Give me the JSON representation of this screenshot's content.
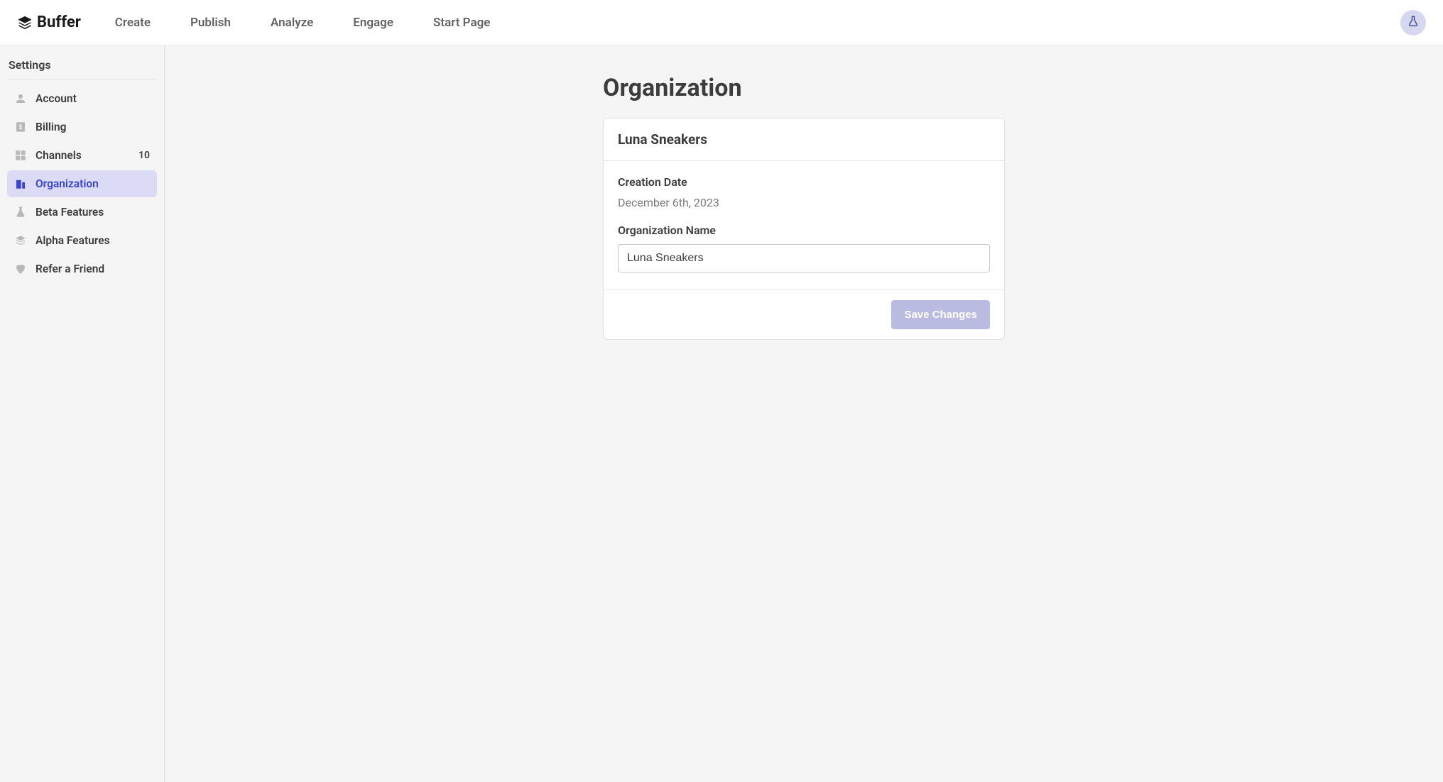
{
  "topbar": {
    "brand": "Buffer",
    "nav": [
      "Create",
      "Publish",
      "Analyze",
      "Engage",
      "Start Page"
    ]
  },
  "sidebar": {
    "title": "Settings",
    "items": [
      {
        "icon": "person",
        "label": "Account"
      },
      {
        "icon": "dollar",
        "label": "Billing"
      },
      {
        "icon": "grid",
        "label": "Channels",
        "count": "10"
      },
      {
        "icon": "building",
        "label": "Organization",
        "active": true
      },
      {
        "icon": "flask",
        "label": "Beta Features"
      },
      {
        "icon": "layers",
        "label": "Alpha Features"
      },
      {
        "icon": "heart",
        "label": "Refer a Friend"
      }
    ]
  },
  "main": {
    "title": "Organization",
    "card": {
      "header": "Luna Sneakers",
      "creation_date_label": "Creation Date",
      "creation_date_value": "December 6th, 2023",
      "org_name_label": "Organization Name",
      "org_name_value": "Luna Sneakers",
      "save_button": "Save Changes"
    }
  }
}
